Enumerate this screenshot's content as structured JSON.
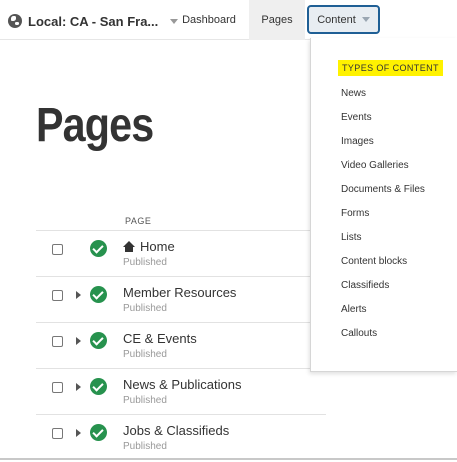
{
  "topnav": {
    "site_label": "Local: CA - San Fra...",
    "dashboard": "Dashboard",
    "pages": "Pages",
    "content": "Content"
  },
  "page": {
    "title": "Pages",
    "column_header": "PAGE"
  },
  "rows": [
    {
      "name": "Home",
      "status": "Published",
      "has_children": false,
      "icon": "home-icon"
    },
    {
      "name": "Member Resources",
      "status": "Published",
      "has_children": true
    },
    {
      "name": "CE & Events",
      "status": "Published",
      "has_children": true
    },
    {
      "name": "News & Publications",
      "status": "Published",
      "has_children": true
    },
    {
      "name": "Jobs & Classifieds",
      "status": "Published",
      "has_children": true
    }
  ],
  "content_menu": {
    "heading": "TYPES OF CONTENT",
    "items": [
      "News",
      "Events",
      "Images",
      "Video Galleries",
      "Documents & Files",
      "Forms",
      "Lists",
      "Content blocks",
      "Classifieds",
      "Alerts",
      "Callouts"
    ]
  },
  "colors": {
    "status_green": "#27924e",
    "highlight_yellow": "#fff200",
    "content_tab_border": "#1f5f95"
  }
}
